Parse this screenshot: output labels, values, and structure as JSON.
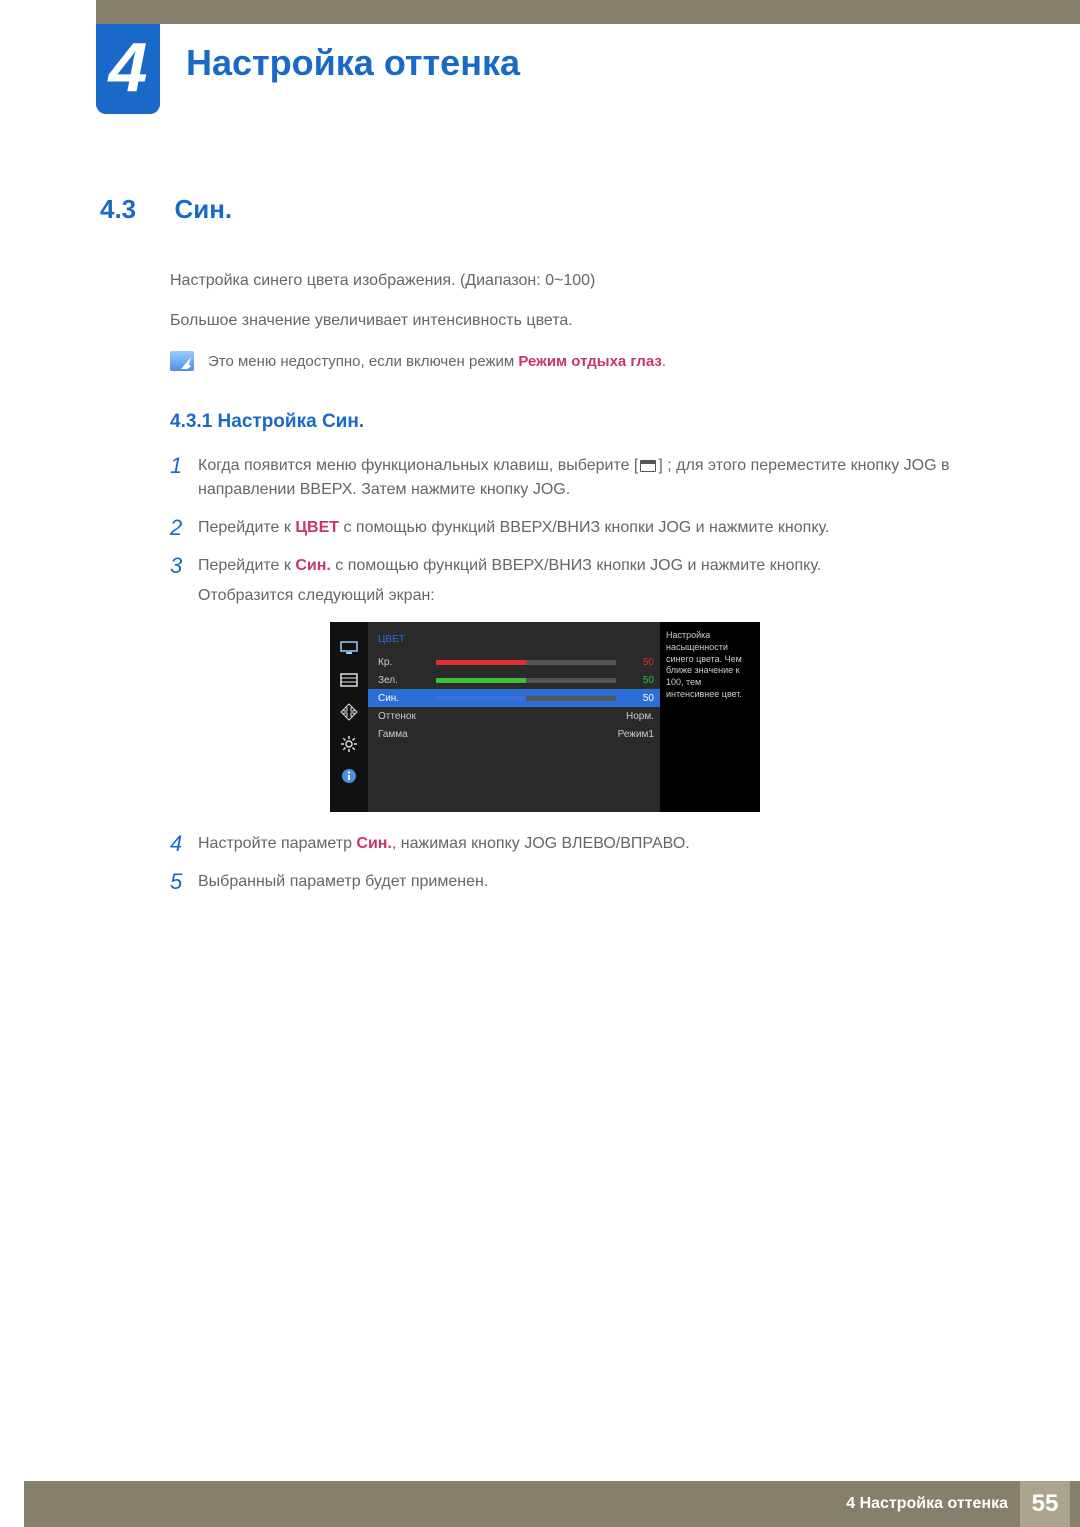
{
  "chapter": {
    "number": "4",
    "title": "Настройка оттенка"
  },
  "section": {
    "number": "4.3",
    "title": "Син."
  },
  "intro": {
    "p1": "Настройка синего цвета изображения. (Диапазон: 0~100)",
    "p2": "Большое значение увеличивает интенсивность цвета."
  },
  "note": {
    "prefix": "Это меню недоступно, если включен режим ",
    "mode": "Режим отдыха глаз",
    "suffix": "."
  },
  "subsection": {
    "heading": "4.3.1 Настройка Син."
  },
  "steps": {
    "s1a": "Когда появится меню функциональных клавиш, выберите [",
    "s1b": "] ; для этого переместите кнопку JOG в направлении ВВЕРХ. Затем нажмите кнопку JOG.",
    "s2a": "Перейдите к ",
    "s2kw": "ЦВЕТ",
    "s2b": " с помощью функций ВВЕРХ/ВНИЗ кнопки JOG и нажмите кнопку.",
    "s3a": "Перейдите к ",
    "s3kw": "Син.",
    "s3b": " с помощью функций ВВЕРХ/ВНИЗ кнопки JOG и нажмите кнопку.",
    "s3c": "Отобразится следующий экран:",
    "s4a": "Настройте параметр ",
    "s4kw": "Син.",
    "s4b": ", нажимая кнопку JOG ВЛЕВО/ВПРАВО.",
    "s5": "Выбранный параметр будет применен."
  },
  "osd": {
    "title": "ЦВЕТ",
    "rows": {
      "r": {
        "label": "Кр.",
        "value": "50"
      },
      "g": {
        "label": "Зел.",
        "value": "50"
      },
      "b": {
        "label": "Син.",
        "value": "50"
      },
      "tone": {
        "label": "Оттенок",
        "value": "Норм."
      },
      "gamma": {
        "label": "Гамма",
        "value": "Режим1"
      }
    },
    "help": "Настройка насыщенности синего цвета.\nЧем ближе значение к 100, тем интенсивнее цвет."
  },
  "footer": {
    "text": "4 Настройка оттенка",
    "page": "55"
  }
}
